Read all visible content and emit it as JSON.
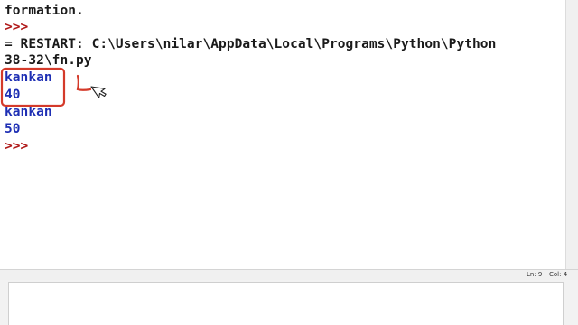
{
  "shell": {
    "lines": [
      {
        "text": "formation.",
        "color": "black"
      },
      {
        "text": ">>>",
        "color": "red"
      },
      {
        "text": "= RESTART: C:\\Users\\nilar\\AppData\\Local\\Programs\\Python\\Python",
        "color": "black"
      },
      {
        "text": "38-32\\fn.py",
        "color": "black"
      },
      {
        "text": "kankan",
        "color": "blue"
      },
      {
        "text": "40",
        "color": "blue"
      },
      {
        "text": "kankan",
        "color": "blue"
      },
      {
        "text": "50",
        "color": "blue"
      },
      {
        "text": ">>>",
        "color": "red"
      }
    ]
  },
  "status": {
    "line": "Ln: 9",
    "col": "Col: 4"
  },
  "annotation_color": "#d43a2a"
}
